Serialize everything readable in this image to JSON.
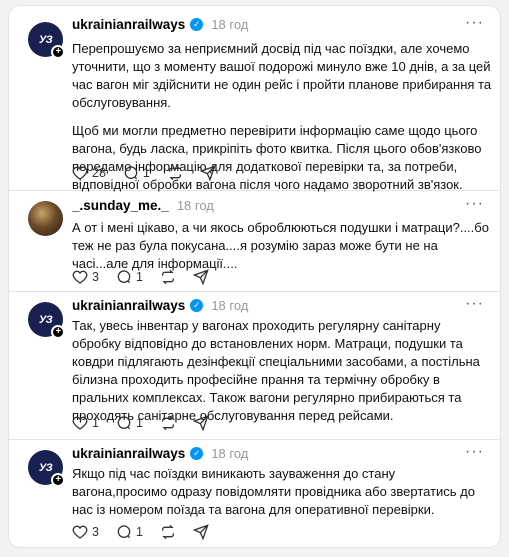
{
  "posts": [
    {
      "avatar_text": "УЗ",
      "username": "ukrainianrailways",
      "verified": true,
      "time": "18 год",
      "paragraphs": [
        "Перепрошуємо за неприємний досвід під час поїздки, але хочемо уточнити, що з моменту вашої подорожі минуло вже 10 днів, а за цей час вагон міг здійснити не один рейс і пройти планове прибирання та обслуговування.",
        "Щоб ми могли предметно перевірити інформацію саме щодо цього вагона, будь ласка, прикріпіть фото квитка. Після цього обов'язково передамо інформацію для додаткової перевірки та, за потреби, відповідної обробки вагона після чого надамо зворотний зв'язок."
      ],
      "likes": "28",
      "replies": "1"
    },
    {
      "avatar_text": "",
      "username": "_.sunday_me._",
      "verified": false,
      "time": "18 год",
      "paragraphs": [
        "А от і мені цікаво, а чи якось оброблюються подушки і матраци?....бо теж не раз була покусана....я розумію зараз може бути не на часі...але для інформації...."
      ],
      "likes": "3",
      "replies": "1"
    },
    {
      "avatar_text": "УЗ",
      "username": "ukrainianrailways",
      "verified": true,
      "time": "18 год",
      "paragraphs": [
        "Так, увесь інвентар у вагонах проходить регулярну санітарну обробку відповідно до встановлених норм. Матраци, подушки та ковдри підлягають дезінфекції спеціальними засобами, а постільна білизна проходить професійне прання та термічну обробку в пральних комплексах. Також вагони регулярно прибираються та проходять санітарне обслуговування перед рейсами."
      ],
      "likes": "1",
      "replies": "1"
    },
    {
      "avatar_text": "УЗ",
      "username": "ukrainianrailways",
      "verified": true,
      "time": "18 год",
      "paragraphs": [
        "Якщо під час поїздки виникають зауваження до стану вагона,просимо одразу повідомляти провідника або звертатись до нас із номером поїзда та вагона для оперативної перевірки."
      ],
      "likes": "3",
      "replies": "1"
    }
  ],
  "icons": {
    "more": "more-dots-icon",
    "like": "heart-icon",
    "reply": "comment-icon",
    "repost": "repost-icon",
    "share": "share-icon",
    "verified": "verified-badge-icon",
    "follow": "plus-icon"
  },
  "colors": {
    "verified": "#0095f6",
    "avatar_brand": "#18214f",
    "muted": "#999999"
  }
}
